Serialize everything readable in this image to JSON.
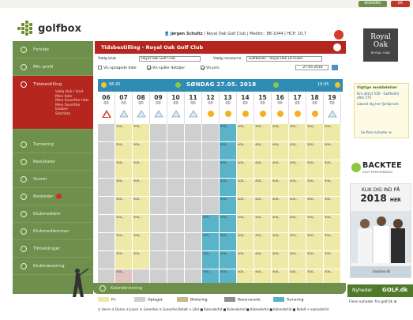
{
  "topbar": {
    "green_btn": "BOOKING",
    "red_btn": "DK"
  },
  "header": {
    "brand": "golfbox",
    "user_name": "Jørgen Schultz",
    "club": "Royal Oak Golf Club",
    "member_no": "Medlnr.: 88-1044",
    "hcp": "HCP: 10,7"
  },
  "sidebar": {
    "items": [
      {
        "label": "Forside"
      },
      {
        "label": "Min profil"
      },
      {
        "label": "Tidsbestilling",
        "subs": [
          "Vælg klub / land",
          "Mine tider",
          "Mine favoritter tider",
          "Mine favoritter klubber",
          "Startliste"
        ]
      },
      {
        "label": "Turnering"
      },
      {
        "label": "Resultater"
      },
      {
        "label": "Scorer"
      },
      {
        "label": "Beskeder",
        "badge": true
      },
      {
        "label": "Klubmedlem"
      },
      {
        "label": "Klubmedlemmer"
      },
      {
        "label": "Tilmeldinger"
      },
      {
        "label": "Klubtrænering"
      }
    ]
  },
  "main": {
    "title": "Tidsbestilling - Royal Oak Golf Club",
    "filters": {
      "club_label": "Vælg klub",
      "club_value": "Royal Oak Golf Club",
      "resource_label": "Vælg ressource",
      "resource_value": "Golfbanen - Royal Oak 18 huller",
      "show_booked_label": "Vis optagede tider",
      "show_booked_checked": false,
      "show_player_details_label": "Vis spiller detaljer",
      "show_player_details_checked": true,
      "show_prices_label": "Vis pris",
      "show_prices_checked": true,
      "date": "27-05-2018"
    },
    "datebar": {
      "left": "06:45",
      "center": "SØNDAG 27.05. 2018",
      "right": "19:45"
    },
    "hours": [
      "06",
      "07",
      "08",
      "09",
      "10",
      "11",
      "12",
      "13",
      "14",
      "15",
      "16",
      "17",
      "18",
      "19"
    ],
    "minutes": [
      "00",
      "00",
      "00",
      "00",
      "00",
      "00",
      "00",
      "00",
      "00",
      "00",
      "00",
      "00",
      "00",
      "00"
    ],
    "legend": [
      "Fri",
      "Optaget",
      "Blokering",
      "Reserverede",
      "Turnering"
    ],
    "legend_colors": [
      "#efe9a8",
      "#cfcfcf",
      "#c9b98a",
      "#8e8e8e",
      "#5ab3c9"
    ],
    "symbols": "① Herre  ② Dame  ③ Junior  ④ Greenfee  ⑤ Greenfee Betalt  ✦ Låst   ■ Kalendertid  ■ Kalendertid  ■ Kalendertid  ■ Kalendertid  ■ Betalt + kalendertid",
    "footer": "Kalendervisning"
  },
  "grid": {
    "rows": [
      [
        "",
        "300,-",
        "300,-",
        "",
        "",
        "",
        "",
        "550,-",
        "400,-",
        "400,-",
        "400,-",
        "400,-",
        "300,-",
        "300,-"
      ],
      [
        "",
        "300,-",
        "300,-",
        "",
        "",
        "",
        "",
        "550,-",
        "400,-",
        "400,-",
        "400,-",
        "400,-",
        "300,-",
        "300,-"
      ],
      [
        "",
        "300,-",
        "300,-",
        "",
        "",
        "",
        "",
        "550,-",
        "400,-",
        "400,-",
        "400,-",
        "400,-",
        "300,-",
        "300,-"
      ],
      [
        "",
        "300,-",
        "300,-",
        "",
        "",
        "",
        "",
        "550,-",
        "400,-",
        "400,-",
        "400,-",
        "400,-",
        "300,-",
        "300,-"
      ],
      [
        "",
        "300,-",
        "300,-",
        "",
        "",
        "",
        "",
        "550,-",
        "400,-",
        "400,-",
        "400,-",
        "400,-",
        "300,-",
        "300,-"
      ],
      [
        "",
        "300,-",
        "300,-",
        "",
        "",
        "",
        "550,-",
        "550,-",
        "400,-",
        "400,-",
        "400,-",
        "400,-",
        "300,-",
        "300,-"
      ],
      [
        "",
        "300,-",
        "300,-",
        "",
        "",
        "",
        "550,-",
        "550,-",
        "400,-",
        "400,-",
        "400,-",
        "400,-",
        "300,-",
        "300,-"
      ],
      [
        "",
        "300,-",
        "300,-",
        "",
        "",
        "",
        "550,-",
        "550,-",
        "400,-",
        "400,-",
        "400,-",
        "400,-",
        "300,-",
        "300,-"
      ],
      [
        "",
        "300,-",
        "",
        "",
        "",
        "",
        "550,-",
        "550,-",
        "400,-",
        "400,-",
        "400,-",
        "400,-",
        "300,-",
        "300,-"
      ]
    ],
    "types": [
      [
        "e",
        "f",
        "f",
        "e",
        "e",
        "e",
        "e",
        "t",
        "f",
        "f",
        "f",
        "f",
        "f",
        "f"
      ],
      [
        "e",
        "f",
        "f",
        "e",
        "e",
        "e",
        "e",
        "t",
        "f",
        "f",
        "f",
        "f",
        "f",
        "f"
      ],
      [
        "e",
        "f",
        "f",
        "e",
        "e",
        "e",
        "e",
        "t",
        "f",
        "f",
        "f",
        "f",
        "f",
        "f"
      ],
      [
        "e",
        "f",
        "f",
        "e",
        "e",
        "e",
        "e",
        "t",
        "f",
        "f",
        "f",
        "f",
        "f",
        "f"
      ],
      [
        "e",
        "f",
        "f",
        "e",
        "e",
        "e",
        "e",
        "t",
        "f",
        "f",
        "f",
        "f",
        "f",
        "f"
      ],
      [
        "e",
        "f",
        "f",
        "e",
        "e",
        "e",
        "t",
        "t",
        "f",
        "f",
        "f",
        "f",
        "f",
        "f"
      ],
      [
        "e",
        "f",
        "f",
        "e",
        "e",
        "e",
        "t",
        "t",
        "f",
        "f",
        "f",
        "f",
        "f",
        "f"
      ],
      [
        "e",
        "f",
        "f",
        "e",
        "e",
        "e",
        "t",
        "t",
        "f",
        "f",
        "f",
        "f",
        "f",
        "f"
      ],
      [
        "e",
        "r",
        "e",
        "e",
        "e",
        "e",
        "t",
        "t",
        "f",
        "f",
        "f",
        "f",
        "f",
        "f"
      ]
    ]
  },
  "right": {
    "royal_l1": "Royal",
    "royal_l2": "Oak",
    "royal_l3": "ROYAL OAK",
    "news_head": "Vigtige meddelelser",
    "news_t1": "Fire aktivt 550 - Golfhellet aftel 275",
    "news_t2": "Læssel dig her fjordprivet",
    "news_link": "Se flere nyheder ⊕",
    "backtee": "BACKTEE",
    "backtee_sub": "GOLF PERFORMANCE",
    "ad1": "KLIK DIG IND PÅ",
    "ad2": "2018",
    "ad2_small": "HER",
    "ad_foot": "backtee.dk",
    "nyheder1": "Nyheder",
    "nyheder2": "GOLF.dk",
    "nyline": "Flere nyheder fra golf.dk ⊕"
  }
}
